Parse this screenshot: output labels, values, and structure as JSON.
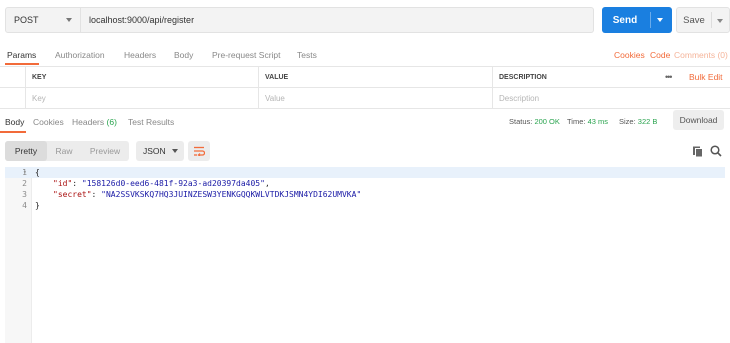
{
  "request": {
    "method": "POST",
    "url": "localhost:9000/api/register",
    "send_label": "Send",
    "save_label": "Save"
  },
  "request_tabs": [
    {
      "label": "Params",
      "active": true
    },
    {
      "label": "Authorization"
    },
    {
      "label": "Headers"
    },
    {
      "label": "Body"
    },
    {
      "label": "Pre-request Script"
    },
    {
      "label": "Tests"
    }
  ],
  "request_links": {
    "cookies": "Cookies",
    "code": "Code",
    "comments": "Comments (0)"
  },
  "params_table": {
    "headers": [
      "KEY",
      "VALUE",
      "DESCRIPTION"
    ],
    "placeholders": [
      "Key",
      "Value",
      "Description"
    ],
    "more": "•••",
    "bulk_edit": "Bulk Edit"
  },
  "response_tabs": [
    {
      "label": "Body",
      "active": true
    },
    {
      "label": "Cookies"
    },
    {
      "label": "Headers",
      "count": "(6)"
    },
    {
      "label": "Test Results"
    }
  ],
  "response_status": {
    "status_label": "Status:",
    "status_value": "200 OK",
    "time_label": "Time:",
    "time_value": "43 ms",
    "size_label": "Size:",
    "size_value": "322 B",
    "download_label": "Download"
  },
  "format_toolbar": {
    "modes": [
      "Pretty",
      "Raw",
      "Preview"
    ],
    "active_mode": "Pretty",
    "language": "JSON"
  },
  "code_lines": [
    {
      "num": "1",
      "text": "{"
    },
    {
      "num": "2",
      "key": "\"id\"",
      "value": "\"158126d0-eed6-481f-92a3-ad20397da405\"",
      "trail": ","
    },
    {
      "num": "3",
      "key": "\"secret\"",
      "value": "\"NA2SSVKSKQ7HQ3JUINZESW3YENKGQQKWLVTDKJSMN4YDI62UMVKA\"",
      "trail": ""
    },
    {
      "num": "4",
      "text": "}"
    }
  ],
  "colors": {
    "accent": "#f26b3a",
    "send": "#1a7fe0",
    "ok_green": "#2aa44f"
  },
  "icons": [
    "chevron-down-icon",
    "wrap-lines-icon",
    "copy-icon",
    "search-icon",
    "fold-arrow-icon"
  ]
}
